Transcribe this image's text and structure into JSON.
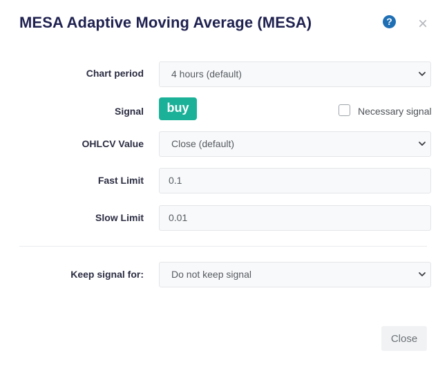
{
  "dialog": {
    "title": "MESA Adaptive Moving Average (MESA)",
    "help_glyph": "?",
    "close_glyph": "×"
  },
  "form": {
    "chart_period": {
      "label": "Chart period",
      "value": "4 hours (default)"
    },
    "signal": {
      "label": "Signal",
      "badge": "buy",
      "necessary_signal_label": "Necessary signal",
      "necessary_signal_checked": false
    },
    "ohlcv_value": {
      "label": "OHLCV Value",
      "value": "Close (default)"
    },
    "fast_limit": {
      "label": "Fast Limit",
      "value": "0.1"
    },
    "slow_limit": {
      "label": "Slow Limit",
      "value": "0.01"
    },
    "keep_signal_for": {
      "label": "Keep signal for:",
      "value": "Do not keep signal"
    }
  },
  "footer": {
    "close_label": "Close"
  },
  "colors": {
    "title": "#1f2150",
    "buy_badge": "#1bb198",
    "help_icon": "#1f6fb5"
  },
  "icons": {
    "help": "question-circle-icon",
    "close": "close-x-icon",
    "select_arrow": "chevron-down-icon"
  }
}
